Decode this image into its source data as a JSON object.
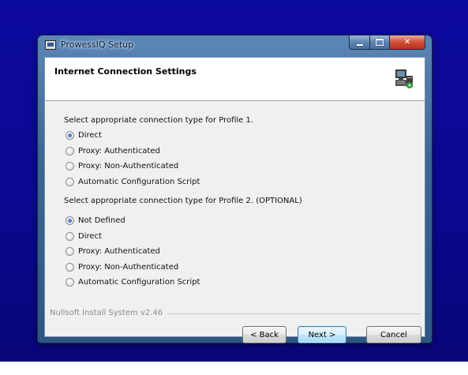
{
  "window": {
    "title": "ProwessIQ Setup"
  },
  "header": {
    "title": "Internet Connection Settings"
  },
  "profile1": {
    "label": "Select appropriate connection type for Profile 1.",
    "options": [
      "Direct",
      "Proxy: Authenticated",
      "Proxy: Non-Authenticated",
      "Automatic Configuration Script"
    ],
    "selected": "Direct"
  },
  "profile2": {
    "label": "Select appropriate connection type for Profile 2. (OPTIONAL)",
    "options": [
      "Not Defined",
      "Direct",
      "Proxy: Authenticated",
      "Proxy: Non-Authenticated",
      "Automatic Configuration Script"
    ],
    "selected": "Not Defined"
  },
  "footer": {
    "branding": "Nullsoft Install System v2.46"
  },
  "buttons": {
    "back": "< Back",
    "next": "Next >",
    "cancel": "Cancel"
  },
  "icons": {
    "app": "installer-icon",
    "header": "computer-network-icon"
  },
  "colors": {
    "desktop": "#0a0890",
    "titlebar": "#3b6796",
    "close_button": "#cf4e35",
    "default_button_border": "#3c7fb1"
  }
}
